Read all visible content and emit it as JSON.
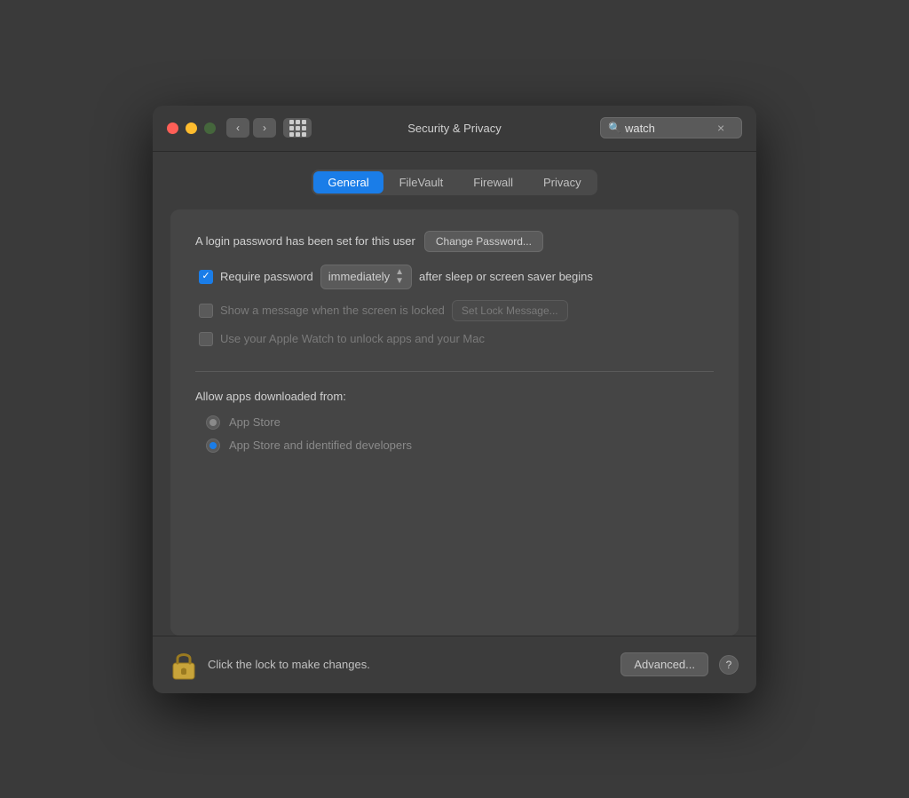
{
  "window": {
    "title": "Security & Privacy"
  },
  "search": {
    "placeholder": "watch",
    "value": "watch",
    "clear_label": "×"
  },
  "tabs": {
    "items": [
      {
        "id": "general",
        "label": "General",
        "active": true
      },
      {
        "id": "filevault",
        "label": "FileVault",
        "active": false
      },
      {
        "id": "firewall",
        "label": "Firewall",
        "active": false
      },
      {
        "id": "privacy",
        "label": "Privacy",
        "active": false
      }
    ]
  },
  "general": {
    "login_password_label": "A login password has been set for this user",
    "change_password_btn": "Change Password...",
    "require_password": {
      "checked": true,
      "label": "Require password",
      "dropdown_value": "immediately",
      "after_label": "after sleep or screen saver begins"
    },
    "lock_message": {
      "checked": false,
      "label": "Show a message when the screen is locked",
      "btn_label": "Set Lock Message..."
    },
    "apple_watch": {
      "checked": false,
      "label": "Use your Apple Watch to unlock apps and your Mac"
    },
    "allow_apps": {
      "title": "Allow apps downloaded from:",
      "options": [
        {
          "id": "app_store",
          "label": "App Store",
          "selected": false
        },
        {
          "id": "app_store_identified",
          "label": "App Store and identified developers",
          "selected": true
        }
      ]
    }
  },
  "footer": {
    "lock_text": "Click the lock to make changes.",
    "advanced_btn": "Advanced...",
    "help_btn": "?"
  }
}
